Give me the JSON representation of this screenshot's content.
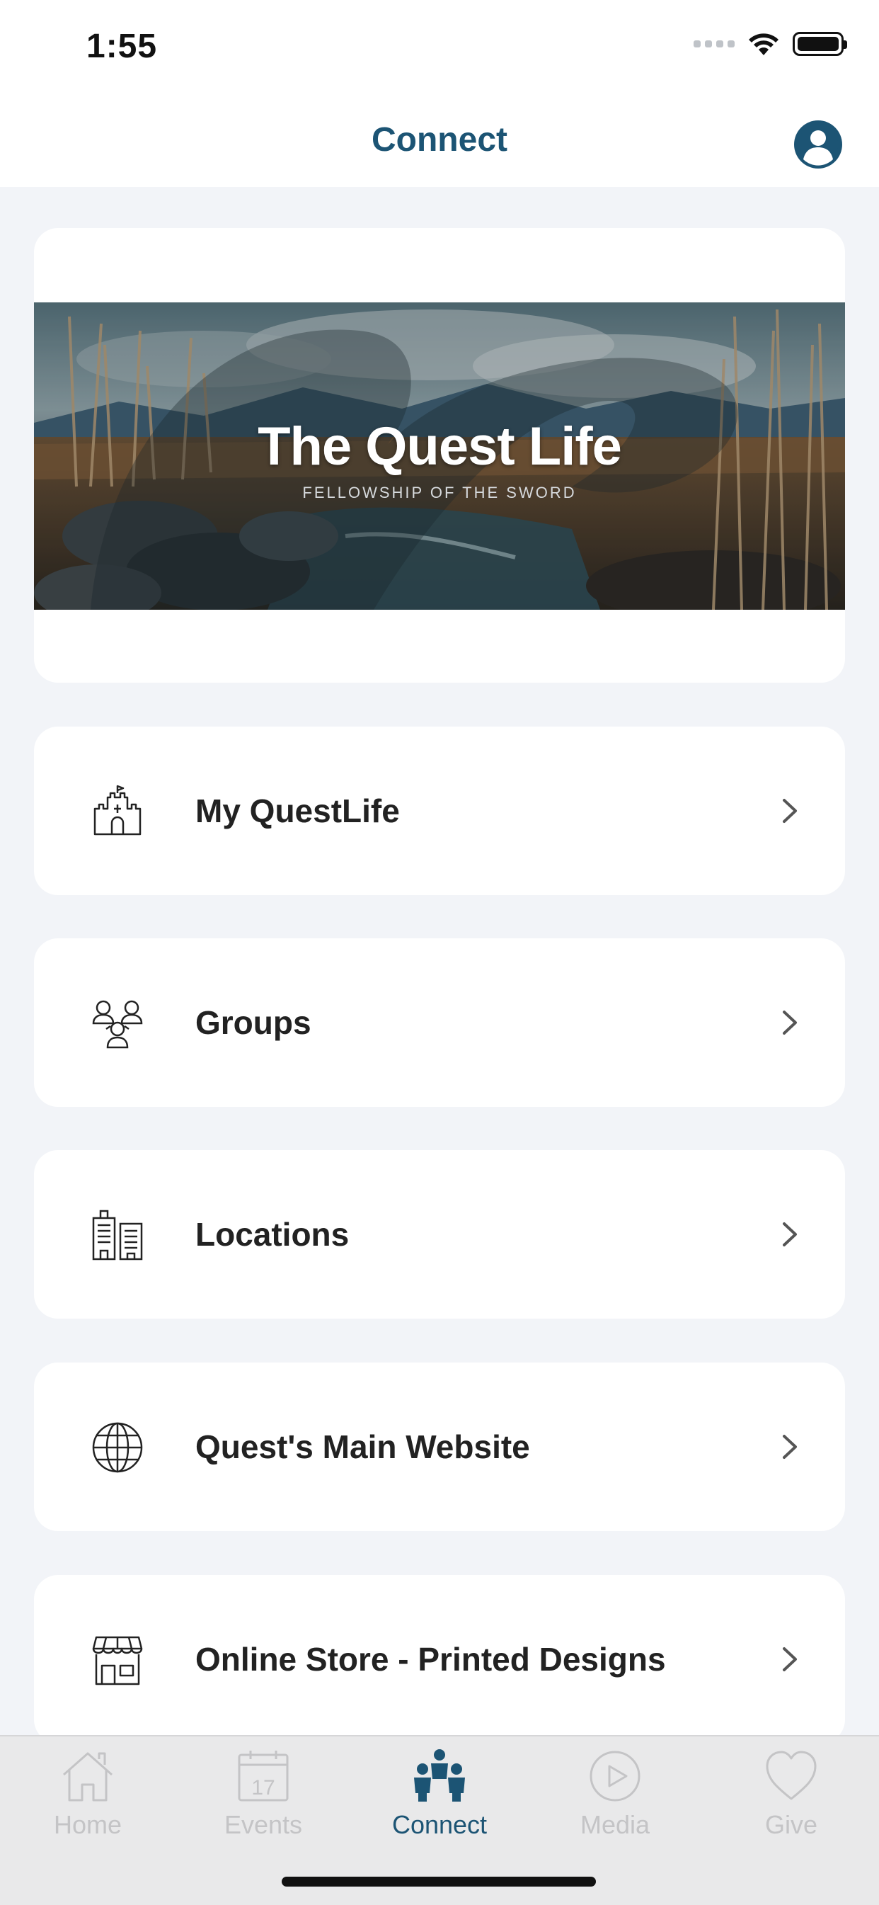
{
  "status_bar": {
    "time": "1:55"
  },
  "nav": {
    "title": "Connect",
    "profile_icon": "person-circle-icon"
  },
  "banner": {
    "title": "The Quest Life",
    "subtitle": "FELLOWSHIP OF THE SWORD"
  },
  "menu": [
    {
      "label": "My QuestLife",
      "icon": "castle-icon"
    },
    {
      "label": "Groups",
      "icon": "people-group-icon"
    },
    {
      "label": "Locations",
      "icon": "buildings-icon"
    },
    {
      "label": "Quest's Main Website",
      "icon": "globe-icon"
    },
    {
      "label": "Online Store - Printed Designs",
      "icon": "storefront-icon"
    }
  ],
  "tabs": [
    {
      "label": "Home",
      "icon": "home-icon",
      "active": false
    },
    {
      "label": "Events",
      "icon": "calendar-icon",
      "calendar_day": "17",
      "active": false
    },
    {
      "label": "Connect",
      "icon": "people-icon",
      "active": true
    },
    {
      "label": "Media",
      "icon": "play-icon",
      "active": false
    },
    {
      "label": "Give",
      "icon": "heart-icon",
      "active": false
    }
  ],
  "colors": {
    "accent": "#1c5474",
    "background": "#f2f4f8",
    "card": "#ffffff",
    "tab_inactive": "#c4c4c6",
    "tab_bar": "#e9e9ea"
  }
}
